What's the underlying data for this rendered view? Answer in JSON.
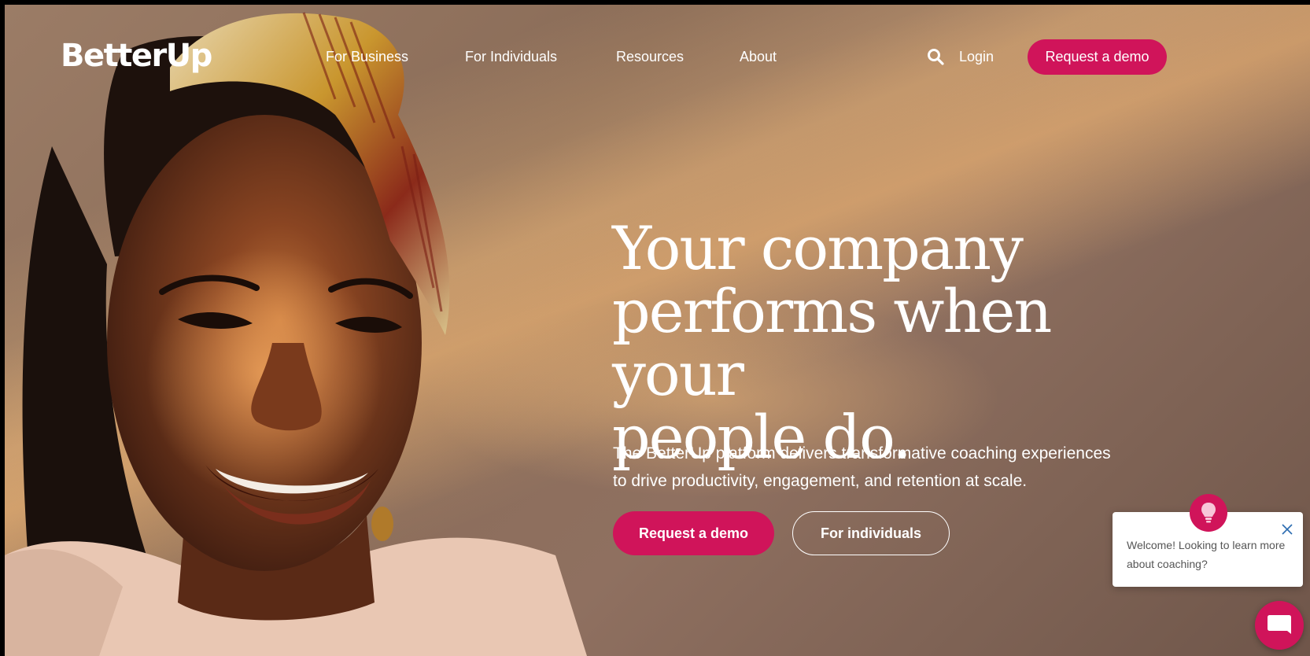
{
  "brand": {
    "logo_text": "BetterUp",
    "accent_color": "#d0145a"
  },
  "nav": {
    "links": [
      {
        "label": "For Business"
      },
      {
        "label": "For Individuals"
      },
      {
        "label": "Resources"
      },
      {
        "label": "About"
      }
    ],
    "search_icon": "search-icon",
    "login_label": "Login",
    "demo_label": "Request a demo"
  },
  "hero": {
    "title_lines": [
      "Your company",
      "performs when your",
      "people do."
    ],
    "subtitle_lines": [
      "The BetterUp platform delivers transformative coaching experiences",
      "to drive productivity, engagement, and retention at scale."
    ],
    "primary_cta": "Request a demo",
    "secondary_cta": "For individuals"
  },
  "chat": {
    "message": "Welcome! Looking to learn more about coaching?",
    "avatar_icon": "lightbulb-icon",
    "close_icon": "close-icon",
    "launcher_icon": "chat-bubble-icon"
  }
}
